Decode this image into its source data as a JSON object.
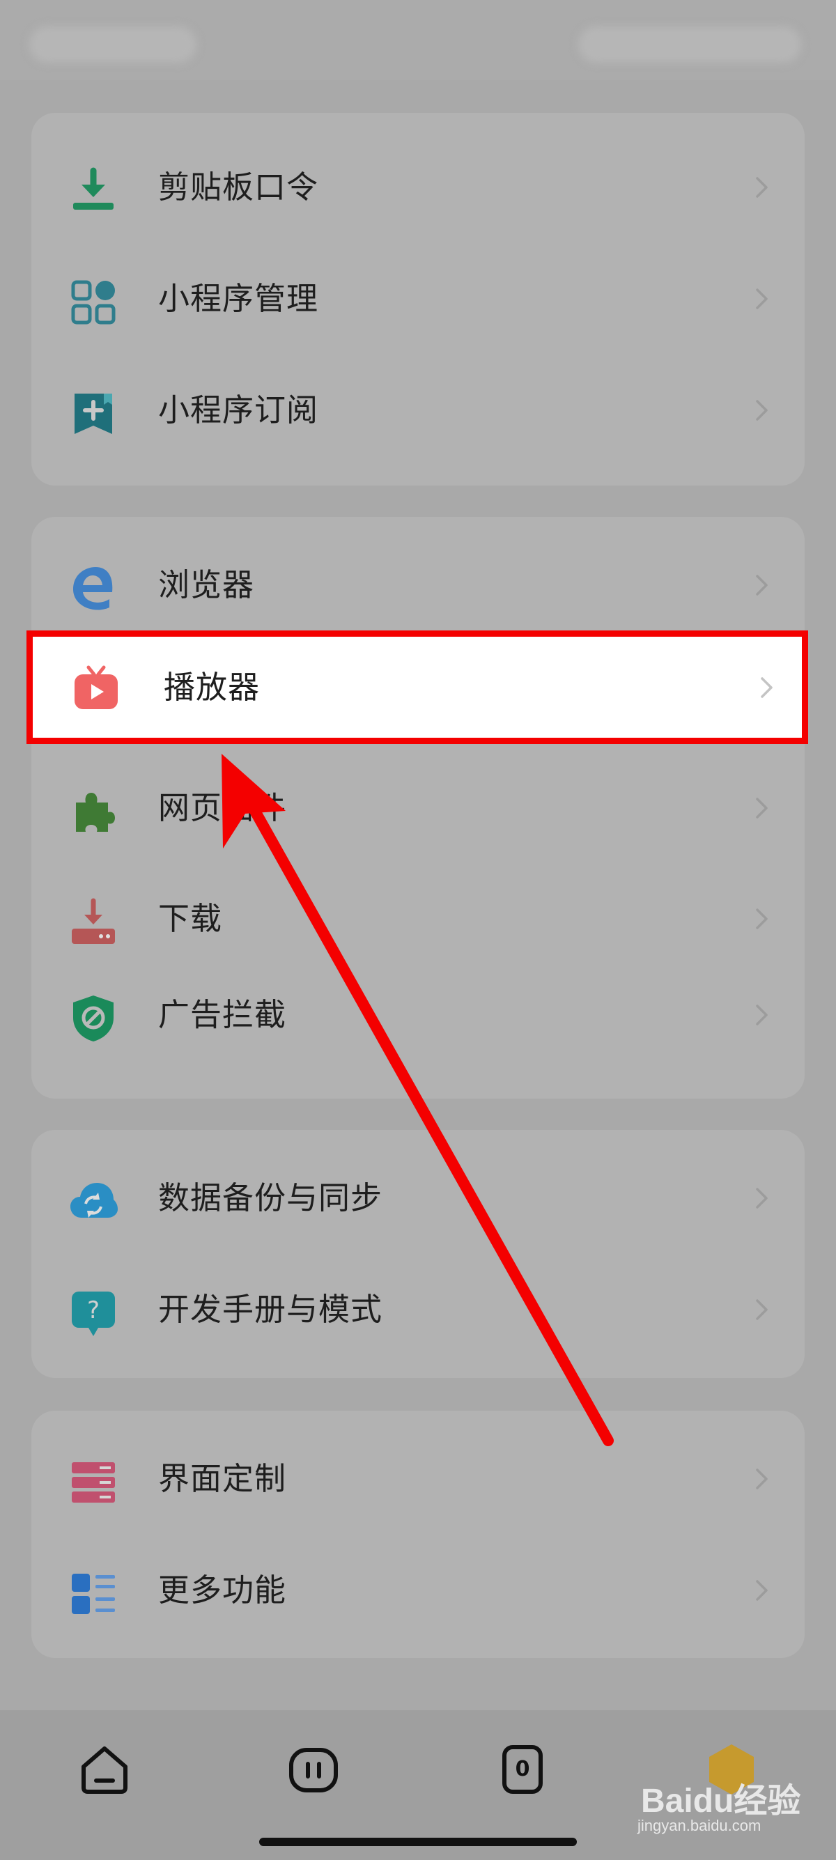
{
  "colors": {
    "highlight_border": "#f40000",
    "arrow": "#f40000",
    "page_background": "#a9a9a9",
    "card_background": "#b2b2b2"
  },
  "groups": [
    {
      "items": [
        {
          "label": "剪贴板口令",
          "icon": "download-tray-icon"
        },
        {
          "label": "小程序管理",
          "icon": "grid-apps-icon"
        },
        {
          "label": "小程序订阅",
          "icon": "bookmark-plus-icon"
        }
      ]
    },
    {
      "items": [
        {
          "label": "浏览器",
          "icon": "edge-browser-icon"
        },
        {
          "label": "播放器",
          "icon": "tv-play-icon"
        },
        {
          "label": "网页插件",
          "icon": "puzzle-icon"
        },
        {
          "label": "下载",
          "icon": "download-drive-icon"
        },
        {
          "label": "广告拦截",
          "icon": "shield-block-icon"
        }
      ]
    },
    {
      "items": [
        {
          "label": "数据备份与同步",
          "icon": "cloud-sync-icon"
        },
        {
          "label": "开发手册与模式",
          "icon": "help-bubble-icon"
        }
      ]
    },
    {
      "items": [
        {
          "label": "界面定制",
          "icon": "layout-list-icon"
        },
        {
          "label": "更多功能",
          "icon": "more-list-icon"
        }
      ]
    }
  ],
  "bottom_nav": {
    "tabs_badge": "0",
    "watermark": "Baidu经验",
    "watermark_sub": "jingyan.baidu.com"
  }
}
